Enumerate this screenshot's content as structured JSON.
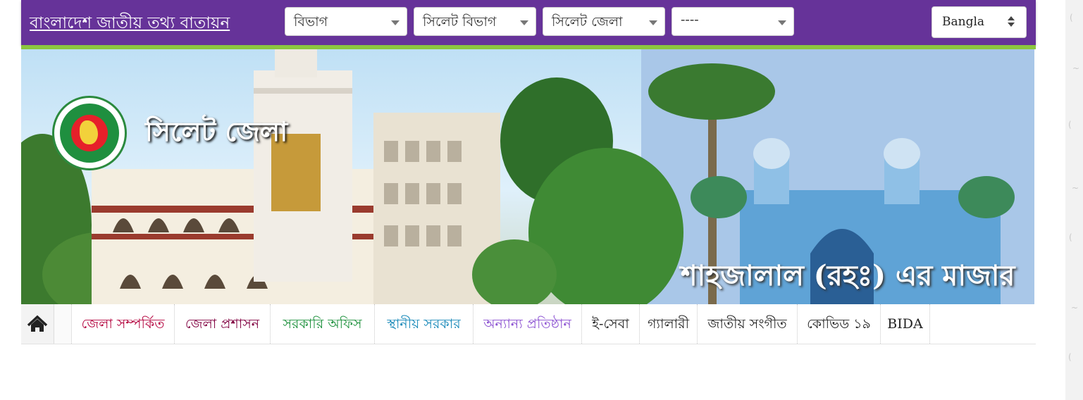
{
  "header": {
    "portal_title": "বাংলাদেশ জাতীয় তথ্য বাতায়ন",
    "selects": [
      {
        "value": "বিভাগ"
      },
      {
        "value": "সিলেট বিভাগ"
      },
      {
        "value": "সিলেট জেলা"
      },
      {
        "value": "----"
      }
    ],
    "language": "Bangla"
  },
  "banner": {
    "district_name": "সিলেট জেলা",
    "caption": "শাহজালাল (রহঃ) এর মাজার"
  },
  "nav": {
    "home_icon": "home-icon",
    "items": [
      {
        "label": "জেলা সম্পর্কিত",
        "color": "#b3003c"
      },
      {
        "label": "জেলা প্রশাসন",
        "color": "#800040"
      },
      {
        "label": "সরকারি অফিস",
        "color": "#1a8f3a"
      },
      {
        "label": "স্থানীয় সরকার",
        "color": "#1487b8"
      },
      {
        "label": "অন্যান্য প্রতিষ্ঠান",
        "color": "#8a4fd1"
      },
      {
        "label": "ই-সেবা",
        "color": "#222222"
      },
      {
        "label": "গ্যালারী",
        "color": "#222222"
      },
      {
        "label": "জাতীয় সংগীত",
        "color": "#222222"
      },
      {
        "label": "কোভিড ১৯",
        "color": "#222222"
      },
      {
        "label": "BIDA",
        "color": "#222222"
      }
    ]
  },
  "colors": {
    "header_bg": "#663399",
    "header_accent": "#8cc63f"
  }
}
